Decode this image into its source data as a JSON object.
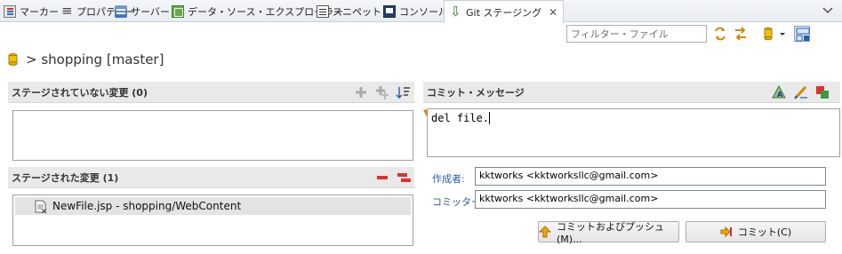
{
  "tabs": [
    {
      "label": "マーカー",
      "icon": "markers-icon"
    },
    {
      "label": "プロパティー",
      "icon": "properties-icon"
    },
    {
      "label": "サーバー",
      "icon": "servers-icon"
    },
    {
      "label": "データ・ソース・エクスプローラー",
      "icon": "data-source-icon"
    },
    {
      "label": "スニペット",
      "icon": "snippets-icon"
    },
    {
      "label": "コンソール",
      "icon": "console-icon"
    },
    {
      "label": "Git ステージング",
      "icon": "git-staging-icon",
      "active": true
    }
  ],
  "toolbar": {
    "filter_placeholder": "フィルター・ファイル"
  },
  "header": {
    "title": "> shopping [master]"
  },
  "unstaged": {
    "title": "ステージされていない変更 (0)",
    "files": []
  },
  "staged": {
    "title": "ステージされた変更 (1)",
    "files": [
      {
        "label": "NewFile.jsp - shopping/WebContent"
      }
    ]
  },
  "commit": {
    "title": "コミット・メッセージ",
    "message": "del file.",
    "author_label": "作成者:",
    "author_value": "kktworks <kktworksllc@gmail.com>",
    "committer_label": "コミッター:",
    "committer_value": "kktworks <kktworksllc@gmail.com>",
    "commit_push_label": "コミットおよびプッシュ(M)...",
    "commit_label": "コミット(C)"
  },
  "colors": {
    "section_header_bg": "#e9e9e9",
    "label_blue": "#2a5ca8",
    "selected_row": "#e3e3e3",
    "git_green": "#2a7a2a"
  }
}
